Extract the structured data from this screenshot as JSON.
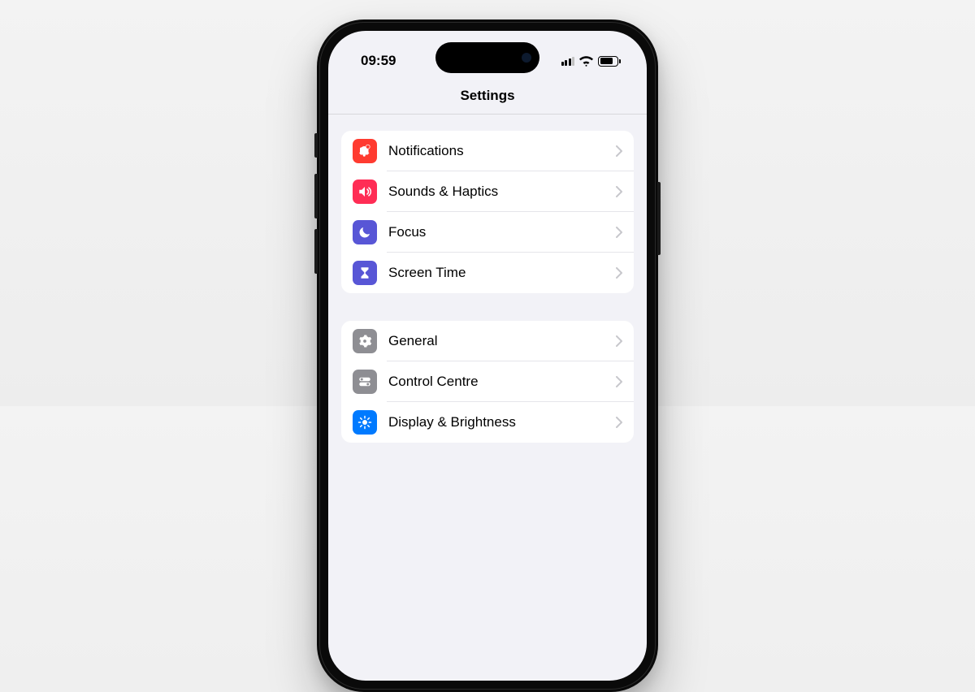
{
  "statusBar": {
    "time": "09:59"
  },
  "header": {
    "title": "Settings"
  },
  "groups": [
    {
      "rows": [
        {
          "id": "notifications",
          "label": "Notifications",
          "icon": "bell-badge-icon",
          "color": "#FF3B30"
        },
        {
          "id": "sounds-haptics",
          "label": "Sounds & Haptics",
          "icon": "speaker-icon",
          "color": "#FF2D55"
        },
        {
          "id": "focus",
          "label": "Focus",
          "icon": "moon-icon",
          "color": "#5856D6"
        },
        {
          "id": "screen-time",
          "label": "Screen Time",
          "icon": "hourglass-icon",
          "color": "#5856D6"
        }
      ]
    },
    {
      "rows": [
        {
          "id": "general",
          "label": "General",
          "icon": "gear-icon",
          "color": "#8E8E93"
        },
        {
          "id": "control-centre",
          "label": "Control Centre",
          "icon": "switches-icon",
          "color": "#8E8E93"
        },
        {
          "id": "display-brightness",
          "label": "Display & Brightness",
          "icon": "brightness-icon",
          "color": "#007AFF"
        }
      ]
    }
  ]
}
